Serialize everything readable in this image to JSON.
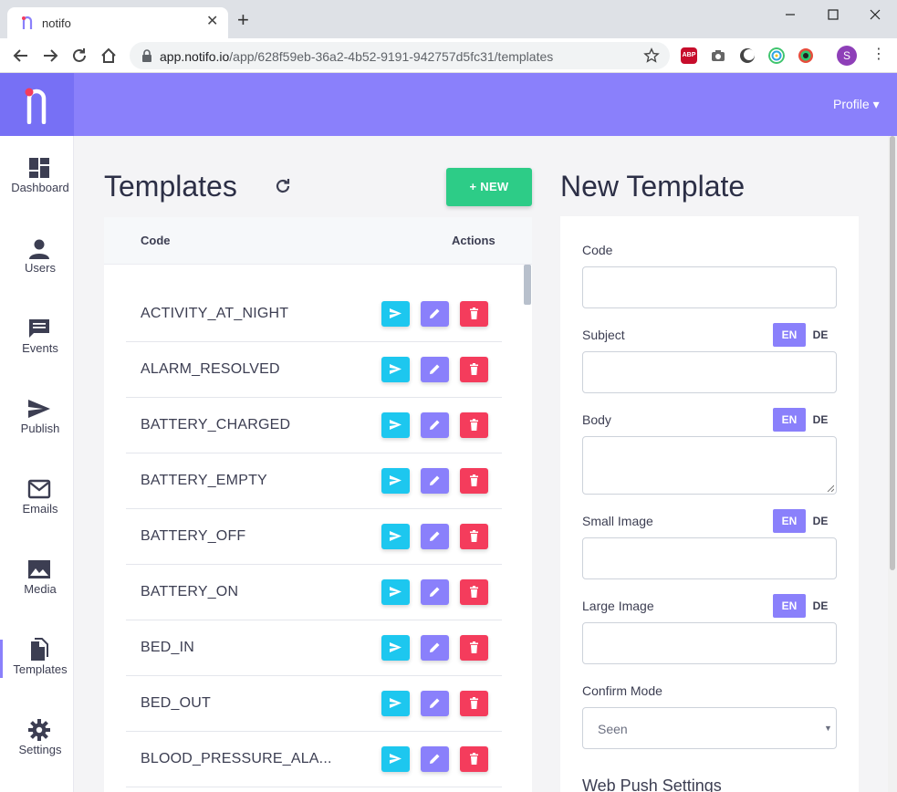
{
  "browser": {
    "tab_title": "notifo",
    "tab_close": "✕",
    "new_tab": "+",
    "url_host": "app.notifo.io",
    "url_path": "/app/628f59eb-36a2-4b52-9191-942757d5fc31/templates",
    "ext_abp": "ABP",
    "avatar_initial": "S",
    "menu": "⋮"
  },
  "header": {
    "profile": "Profile ▾"
  },
  "sidebar": {
    "items": [
      {
        "label": "Dashboard",
        "icon": "dashboard-icon"
      },
      {
        "label": "Users",
        "icon": "user-icon"
      },
      {
        "label": "Events",
        "icon": "chat-icon"
      },
      {
        "label": "Publish",
        "icon": "send-icon"
      },
      {
        "label": "Emails",
        "icon": "mail-icon"
      },
      {
        "label": "Media",
        "icon": "image-icon"
      },
      {
        "label": "Templates",
        "icon": "file-icon",
        "active": true
      },
      {
        "label": "Settings",
        "icon": "gear-icon"
      }
    ]
  },
  "templates": {
    "title": "Templates",
    "new_button": "+ NEW",
    "columns": {
      "code": "Code",
      "actions": "Actions"
    },
    "rows": [
      {
        "code": "ACTIVITY_AT_NIGHT"
      },
      {
        "code": "ALARM_RESOLVED"
      },
      {
        "code": "BATTERY_CHARGED"
      },
      {
        "code": "BATTERY_EMPTY"
      },
      {
        "code": "BATTERY_OFF"
      },
      {
        "code": "BATTERY_ON"
      },
      {
        "code": "BED_IN"
      },
      {
        "code": "BED_OUT"
      },
      {
        "code": "BLOOD_PRESSURE_ALA..."
      }
    ]
  },
  "new_template": {
    "title": "New Template",
    "fields": {
      "code": {
        "label": "Code",
        "value": ""
      },
      "subject": {
        "label": "Subject",
        "value": ""
      },
      "body": {
        "label": "Body",
        "value": ""
      },
      "small_image": {
        "label": "Small Image",
        "value": ""
      },
      "large_image": {
        "label": "Large Image",
        "value": ""
      },
      "confirm_mode": {
        "label": "Confirm Mode",
        "value": "Seen"
      }
    },
    "lang_en": "EN",
    "lang_de": "DE",
    "section_web_push": "Web Push Settings"
  },
  "colors": {
    "brand": "#8a80fb",
    "new_button": "#2dcc87",
    "send": "#1dc7ef",
    "delete": "#f43c5c"
  }
}
